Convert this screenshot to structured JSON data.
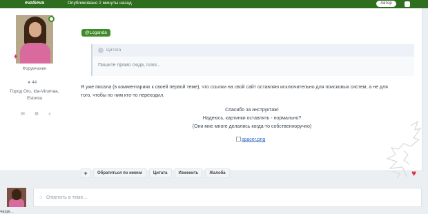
{
  "topbar": {
    "author": "evaSeva",
    "posted": "Опубликовано 2 минуты назад",
    "author_badge": "Автор"
  },
  "profile": {
    "member_title": "Форумчанин",
    "post_count": "44",
    "location_line1": "Город Oru, Ida-Virumaa,",
    "location_line2": "Estonia"
  },
  "post": {
    "mention": "@Loganda",
    "quote": {
      "title": "Цитата",
      "text": "Пишите прямо сюда, плиз..."
    },
    "body_line1": "Я уже писала (в комментариях к своей первой теме), что ссылки на свой сайт оставляю исключительно для поисковых систем, а не для",
    "body_line2": "того, чтобы по ним кто-то переходил.",
    "center_lines": [
      "Спасибо за инструктаж!",
      "Надеюсь, картинки оставлять - нормально?",
      "(Они мне многе делались когда-то собственноручно)"
    ],
    "image_alt": "spacer.png"
  },
  "actions": {
    "add": "+",
    "reply_to": "Обратиться по имени",
    "quote": "Цитата",
    "edit": "Изменить",
    "report": "Жалоба"
  },
  "reply": {
    "placeholder": "Ответить в теме...",
    "cut_text": "чаще..."
  },
  "colors": {
    "brand": "#2e6e1e",
    "accent": "#3f8b2a",
    "heart": "#d8344a"
  }
}
